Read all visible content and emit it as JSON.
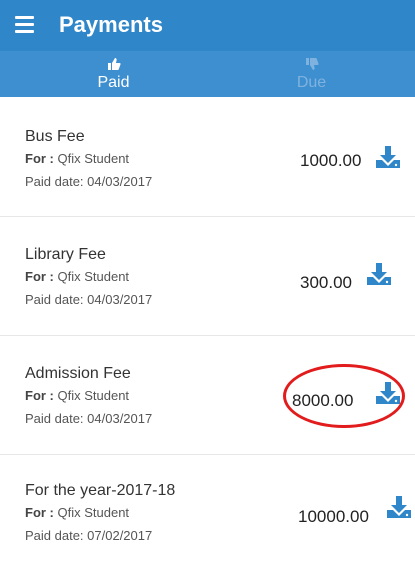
{
  "appbar": {
    "title": "Payments",
    "menu_icon": "menu-icon"
  },
  "tabs": [
    {
      "label": "Paid",
      "icon": "thumbs-up-icon",
      "active": true
    },
    {
      "label": "Due",
      "icon": "thumbs-down-icon",
      "active": false
    }
  ],
  "payments": [
    {
      "name": "Bus Fee",
      "for_label": "For :",
      "for_value": " Qfix Student",
      "date": "Paid date: 04/03/2017",
      "amount": "1000.00",
      "icon": "download-icon"
    },
    {
      "name": "Library Fee",
      "for_label": "For :",
      "for_value": " Qfix Student",
      "date": "Paid date: 04/03/2017",
      "amount": "300.00",
      "icon": "download-icon"
    },
    {
      "name": "Admission Fee",
      "for_label": "For :",
      "for_value": " Qfix Student",
      "date": "Paid date: 04/03/2017",
      "amount": "8000.00",
      "icon": "download-icon",
      "highlighted": true
    },
    {
      "name": "For the year-2017-18",
      "for_label": "For :",
      "for_value": " Qfix Student",
      "date": "Paid date: 07/02/2017",
      "amount": "10000.00",
      "icon": "download-icon"
    }
  ],
  "colors": {
    "appbar": "#2f86c9",
    "tabbar": "#3d8fd0",
    "icon": "#2f86c9",
    "highlight": "#e21c1c"
  }
}
